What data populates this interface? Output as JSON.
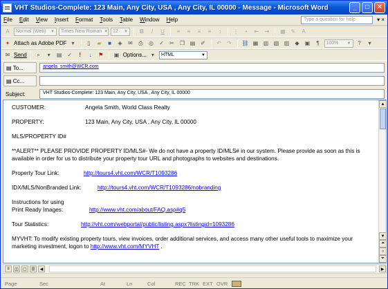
{
  "window": {
    "title": "VHT Studios-Complete: 123 Main, Any City, USA , Any City, IL 00000 - Message - Microsoft Word",
    "minimize": "_",
    "maximize": "□",
    "close": "✕"
  },
  "menu": {
    "items": [
      "File",
      "Edit",
      "View",
      "Insert",
      "Format",
      "Tools",
      "Table",
      "Window",
      "Help"
    ],
    "help_placeholder": "Type a question for help",
    "close_glyph": "▾ ×"
  },
  "format_toolbar": {
    "style_value": "Normal (Web)",
    "font_value": "Times New Roman",
    "size_value": "12"
  },
  "standard_toolbar": {
    "attach_label": "Attach as Adobe PDF",
    "zoom_value": "100%"
  },
  "send_toolbar": {
    "send_label": "Send",
    "options_label": "Options...",
    "format_value": "HTML"
  },
  "fields": {
    "to_label": "To...",
    "to_value": "angela_smith@WCR.com",
    "cc_label": "Cc...",
    "cc_value": "",
    "subject_label": "Subject:",
    "subject_value": "VHT Studios-Complete: 123 Main, Any City, USA , Any City, IL 00000"
  },
  "document": {
    "customer_label": "CUSTOMER:",
    "customer_value": "Angela Smith, World Class Realty",
    "property_label": "PROPERTY:",
    "property_value": "123 Main, Any City, USA , Any City, IL 00000",
    "mls_label": "MLS/PROPERTY ID#",
    "alert_text": "**ALERT** PLEASE PROVIDE PROPERTY ID/MLS#- We do not have a property ID/MLS# in our system. Please provide as soon as this is available in order for us to distribute your property tour URL and photographs to websites and destinations.",
    "tour_label": "Property Tour Link:",
    "tour_url": "http://tours4.vht.com/WCR/T1093286",
    "idx_label": "IDX/MLS/NonBranded Link:",
    "idx_url": "http://tours4.vht.com/WCR/T1093286/nobranding",
    "print_label_1": "Instructions for using",
    "print_label_2": "Print Ready Images:",
    "print_url": "http://www.vht.com/about/FAQ.asp#q5",
    "stats_label": "Tour Statistics:",
    "stats_url": "http://vht.com/webportal/public/listing.aspx?listingid=1093286",
    "myvht_text": "MYVHT:  To modify existing property tours, view invoices, order additional services, and access many other useful tools to maximize your marketing investment, logon to",
    "myvht_url": "http://www.vht.com/MYVHT",
    "myvht_tail": " ."
  },
  "status": {
    "page": "Page",
    "sec": "Sec",
    "at": "At",
    "ln": "Ln",
    "col": "Col",
    "rec": "REC",
    "trk": "TRK",
    "ext": "EXT",
    "ovr": "OVR"
  }
}
